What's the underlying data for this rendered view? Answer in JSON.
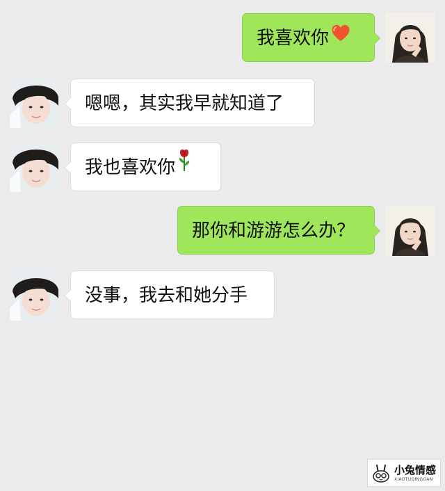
{
  "messages": [
    {
      "side": "out",
      "text": "我喜欢你",
      "emoji": "heart-icon"
    },
    {
      "side": "in",
      "text": "嗯嗯，其实我早就知道了"
    },
    {
      "side": "in",
      "text": "我也喜欢你",
      "emoji": "rose-icon"
    },
    {
      "side": "out",
      "text": "那你和游游怎么办？"
    },
    {
      "side": "in",
      "text": "没事，我去和她分手"
    }
  ],
  "watermark": {
    "title": "小兔情感",
    "subtitle": "XIAOTUQINGGAN"
  },
  "colors": {
    "background": "#ebebeb",
    "incoming_bubble": "#ffffff",
    "outgoing_bubble": "#9fe65a",
    "heart": "#f0522d",
    "rose": "#c81e1e"
  }
}
